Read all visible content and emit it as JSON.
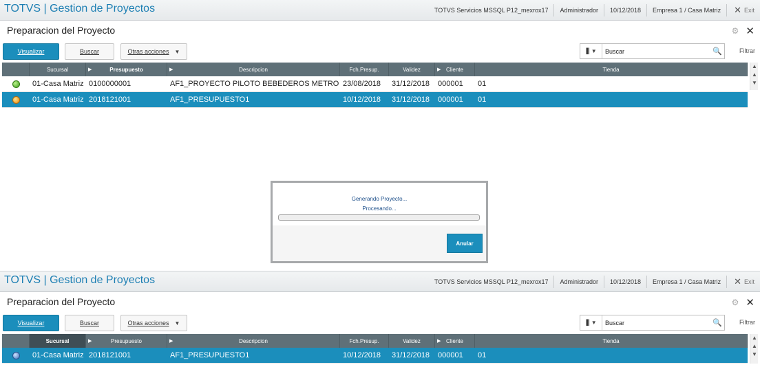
{
  "app_title": "TOTVS | Gestion de Proyectos",
  "top_info": [
    "TOTVS Servicios MSSQL P12_mexrox17",
    "Administrador",
    "10/12/2018",
    "Empresa 1 / Casa Matriz"
  ],
  "exit_label": "Exit",
  "page_title": "Preparacion del Proyecto",
  "toolbar": {
    "view_label": "Visualizar",
    "search_label": "Buscar",
    "more_label": "Otras acciones",
    "search_placeholder": "Buscar",
    "filter_label": "Filtrar"
  },
  "grid": {
    "columns": [
      "Sucursal",
      "Presupuesto",
      "Descripcion",
      "Fch.Presup.",
      "Validez",
      "Cliente",
      "Tienda"
    ]
  },
  "top_rows": [
    {
      "status": "green",
      "sucursal": "01-Casa Matriz",
      "presupuesto": "0100000001",
      "descripcion": "AF1_PROYECTO PILOTO BEBEDEROS METRO",
      "fecha": "23/08/2018",
      "validez": "31/12/2018",
      "cliente": "000001",
      "tienda": "01"
    },
    {
      "status": "orange",
      "sucursal": "01-Casa Matriz",
      "presupuesto": "2018121001",
      "descripcion": "AF1_PRESUPUESTO1",
      "fecha": "10/12/2018",
      "validez": "31/12/2018",
      "cliente": "000001",
      "tienda": "01"
    }
  ],
  "bottom_rows": [
    {
      "status": "blue",
      "sucursal": "01-Casa Matriz",
      "presupuesto": "2018121001",
      "descripcion": "AF1_PRESUPUESTO1",
      "fecha": "10/12/2018",
      "validez": "31/12/2018",
      "cliente": "000001",
      "tienda": "01"
    }
  ],
  "dialog": {
    "title": "Generando Proyecto...",
    "status": "Procesando...",
    "progress": 0,
    "cancel_label": "Anular"
  },
  "colors": {
    "accent": "#1b8ebc",
    "header": "#5f7078",
    "title": "#1d7fb3"
  }
}
